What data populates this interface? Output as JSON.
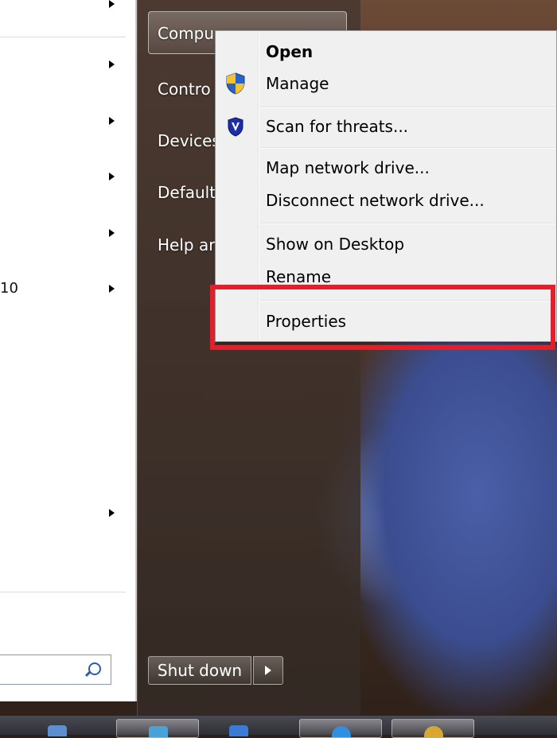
{
  "start_menu": {
    "left_panel": {
      "partial_text": "10",
      "search": {
        "placeholder": ""
      }
    },
    "right_panel": {
      "items": [
        {
          "label": "Compu"
        },
        {
          "label": "Contro"
        },
        {
          "label": "Devices"
        },
        {
          "label": "Default"
        },
        {
          "label": "Help ar"
        }
      ],
      "shutdown_label": "Shut down"
    }
  },
  "context_menu": {
    "items": [
      {
        "label": "Open",
        "bold": true,
        "icon": ""
      },
      {
        "label": "Manage",
        "bold": false,
        "icon": "uac-shield-icon"
      },
      {
        "label": "Scan for threats...",
        "bold": false,
        "icon": "antivirus-shield-icon"
      },
      {
        "label": "Map network drive...",
        "bold": false,
        "icon": ""
      },
      {
        "label": "Disconnect network drive...",
        "bold": false,
        "icon": ""
      },
      {
        "label": "Show on Desktop",
        "bold": false,
        "icon": ""
      },
      {
        "label": "Rename",
        "bold": false,
        "icon": ""
      },
      {
        "label": "Properties",
        "bold": false,
        "icon": ""
      }
    ],
    "highlighted_item": "Properties",
    "highlight_color": "#e0202a"
  },
  "taskbar": {
    "buttons": [
      {
        "icon": "explorer-icon"
      },
      {
        "icon": "media-icon"
      },
      {
        "icon": "network-icon"
      },
      {
        "icon": "browser-icon"
      },
      {
        "icon": "app-icon"
      }
    ]
  }
}
